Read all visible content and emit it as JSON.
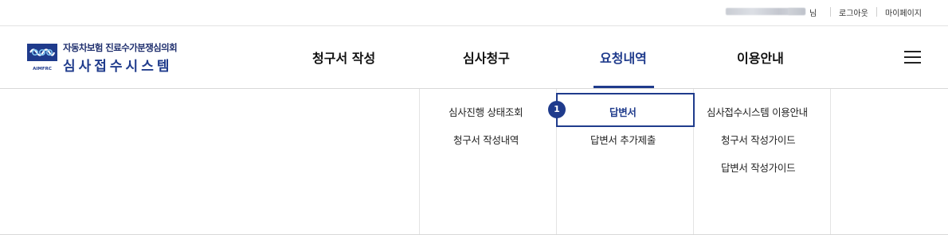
{
  "topbar": {
    "user_suffix": "님",
    "logout_label": "로그아웃",
    "mypage_label": "마이페이지"
  },
  "logo": {
    "org_name": "자동차보험 진료수가분쟁심의회",
    "system_name": "심사접수시스템",
    "emblem_caption": "AIMFRC",
    "brand_color": "#1f3b8c"
  },
  "gnb": {
    "items": [
      {
        "label": "청구서 작성",
        "active": false
      },
      {
        "label": "심사청구",
        "active": false
      },
      {
        "label": "요청내역",
        "active": true
      },
      {
        "label": "이용안내",
        "active": false
      }
    ],
    "menu_icon": "hamburger-icon"
  },
  "submenu": {
    "columns": [
      {
        "items": [
          "심사진행 상태조회",
          "청구서 작성내역"
        ]
      },
      {
        "items": [
          "답변서",
          "답변서 추가제출"
        ],
        "selected": "답변서"
      },
      {
        "items": [
          "심사접수시스템 이용안내",
          "청구서 작성가이드",
          "답변서 작성가이드"
        ]
      }
    ],
    "step_badge": "1"
  }
}
